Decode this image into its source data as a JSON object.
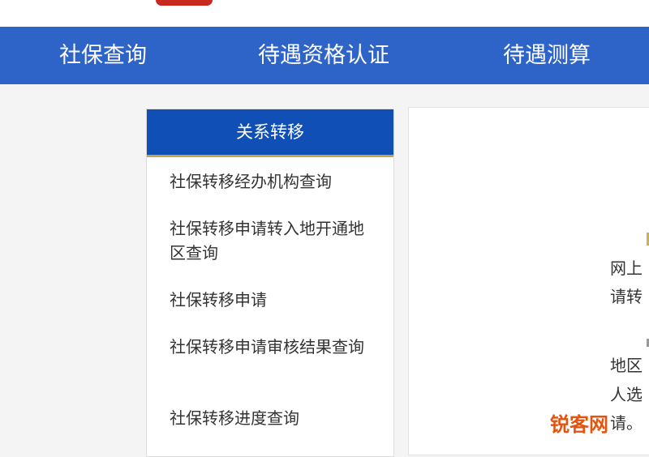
{
  "nav": {
    "items": [
      "社保查询",
      "待遇资格认证",
      "待遇测算"
    ]
  },
  "sidebar": {
    "title": "关系转移",
    "items": [
      "社保转移经办机构查询",
      "社保转移申请转入地开通地区查询",
      "社保转移申请",
      "社保转移申请审核结果查询",
      "社保转移进度查询"
    ]
  },
  "content": {
    "lines": [
      "网上",
      "请转",
      "地区",
      "人选",
      "请。"
    ]
  },
  "watermark": "锐客网",
  "colors": {
    "nav_bg": "#2e63c8",
    "sidebar_header_bg": "#0f4fb6",
    "accent_gold": "#c8a24a",
    "logo_red": "#c8281e",
    "watermark_orange": "#e4540f"
  }
}
